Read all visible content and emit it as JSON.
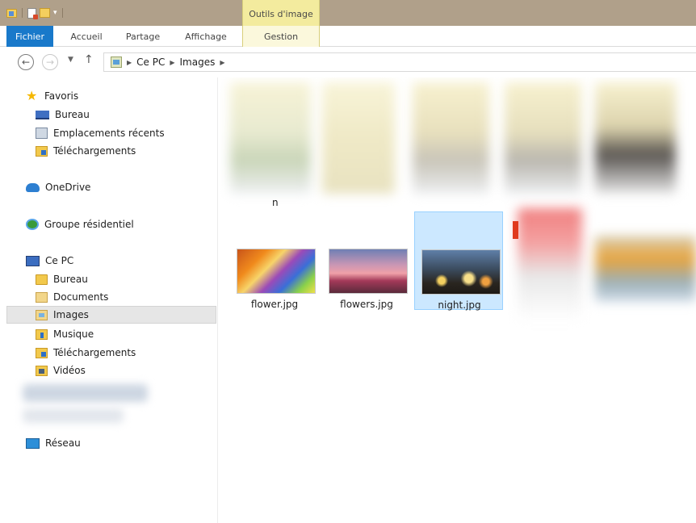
{
  "ribbon": {
    "contextual_group": "Outils d'image",
    "tabs": [
      {
        "label": "Fichier"
      },
      {
        "label": "Accueil"
      },
      {
        "label": "Partage"
      },
      {
        "label": "Affichage"
      },
      {
        "label": "Gestion"
      }
    ]
  },
  "address": {
    "crumbs": [
      "Ce PC",
      "Images"
    ]
  },
  "sidebar": {
    "favorites": {
      "label": "Favoris",
      "items": [
        {
          "label": "Bureau",
          "icon": "desktop-icon"
        },
        {
          "label": "Emplacements récents",
          "icon": "recent-places-icon"
        },
        {
          "label": "Téléchargements",
          "icon": "downloads-icon"
        }
      ]
    },
    "onedrive": "OneDrive",
    "homegroup": "Groupe résidentiel",
    "thispc": {
      "label": "Ce PC",
      "items": [
        {
          "label": "Bureau",
          "icon": "folder-icon"
        },
        {
          "label": "Documents",
          "icon": "documents-icon"
        },
        {
          "label": "Images",
          "icon": "images-icon",
          "selected": true
        },
        {
          "label": "Musique",
          "icon": "music-icon"
        },
        {
          "label": "Téléchargements",
          "icon": "downloads-icon"
        },
        {
          "label": "Vidéos",
          "icon": "videos-icon"
        }
      ]
    },
    "network": "Réseau"
  },
  "content": {
    "blurred_label": "n",
    "files": [
      {
        "name": "flower.jpg",
        "selected": false
      },
      {
        "name": "flowers.jpg",
        "selected": false
      },
      {
        "name": "night.jpg",
        "selected": true
      }
    ]
  }
}
